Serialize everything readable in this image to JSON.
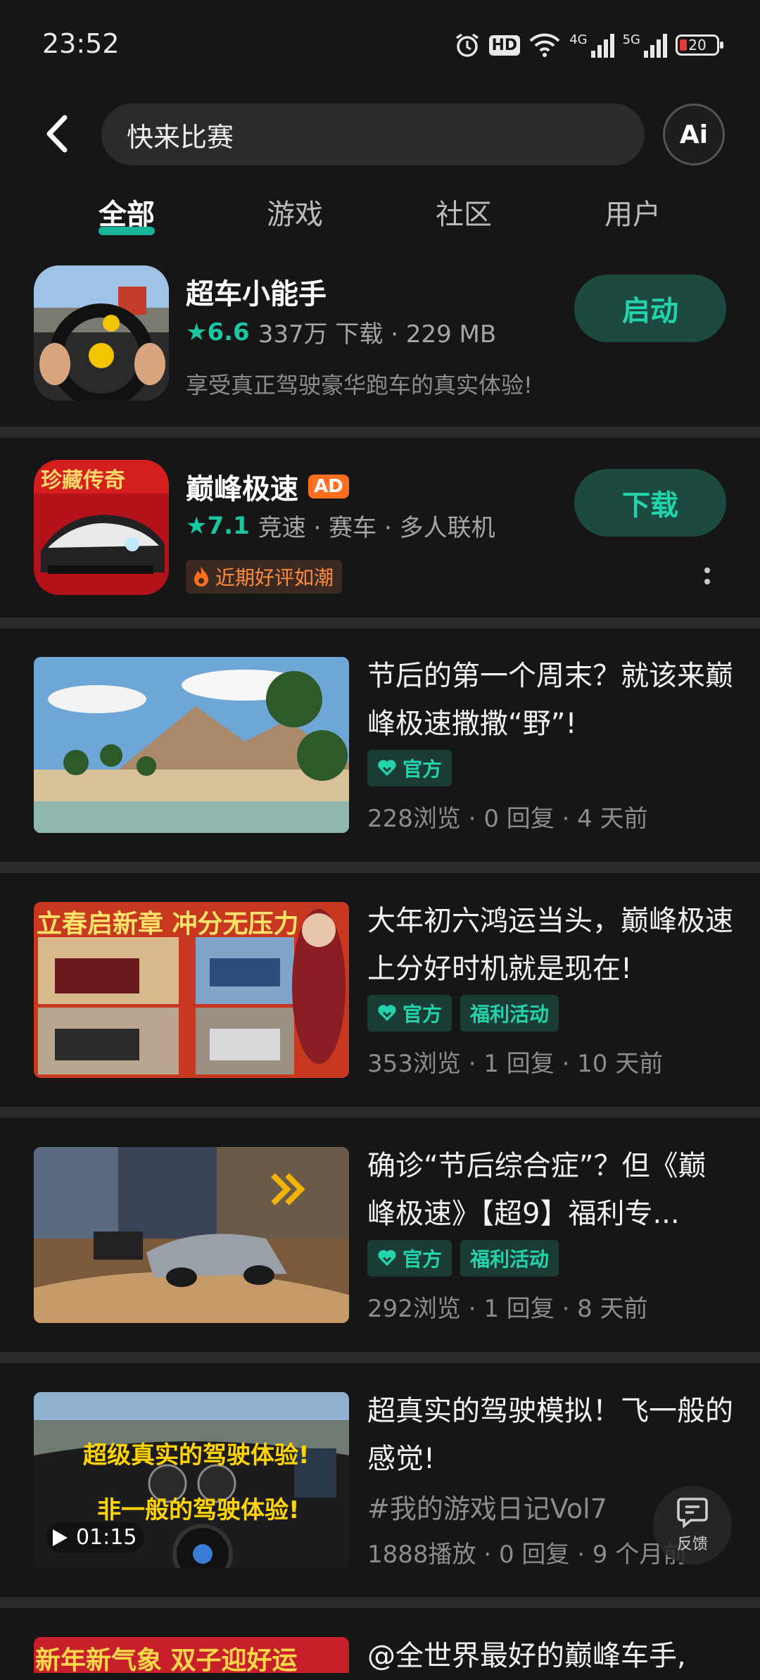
{
  "status_bar": {
    "time": "23:52",
    "hd": "HD",
    "net1": "4G",
    "net2": "5G",
    "battery": "20"
  },
  "search": {
    "query": "快来比赛",
    "ai_label": "Ai"
  },
  "tabs": [
    {
      "label": "全部",
      "active": true
    },
    {
      "label": "游戏",
      "active": false
    },
    {
      "label": "社区",
      "active": false
    },
    {
      "label": "用户",
      "active": false
    }
  ],
  "apps": [
    {
      "name": "超车小能手",
      "rating": "6.6",
      "meta": "337万 下载 · 229 MB",
      "desc": "享受真正驾驶豪华跑车的真实体验!",
      "button": "启动"
    },
    {
      "name": "巅峰极速",
      "ad": "AD",
      "rating": "7.1",
      "meta": "竞速 · 赛车 · 多人联机",
      "hot_tag": "近期好评如潮",
      "button": "下载",
      "icon_text": "珍藏传奇"
    }
  ],
  "posts": [
    {
      "title": "节后的第一个周末？就该来巅峰极速撒撒“野”!",
      "tags": [
        "官方"
      ],
      "meta": "228浏览 · 0 回复 · 4 天前"
    },
    {
      "title": "大年初六鸿运当头，巅峰极速上分好时机就是现在!",
      "tags": [
        "官方",
        "福利活动"
      ],
      "meta": "353浏览 · 1 回复 · 10 天前",
      "thumb_text": "立春启新章 冲分无压力"
    },
    {
      "title": "确诊“节后综合症”？但《巅峰极速》【超9】福利专...",
      "tags": [
        "官方",
        "福利活动"
      ],
      "meta": "292浏览 · 1 回复 · 8 天前"
    },
    {
      "title": "超真实的驾驶模拟！飞一般的感觉!",
      "hashtag": "#我的游戏日记Vol7",
      "meta": "1888播放 · 0 回复 · 9 个月前",
      "duration": "01:15",
      "thumb_line1": "超级真实的驾驶体验!",
      "thumb_line2": "非一般的驾驶体验!"
    },
    {
      "title": "@全世界最好的巅峰车手,",
      "thumb_text": "新年新气象 双子迎好运"
    }
  ],
  "feedback_label": "反馈"
}
